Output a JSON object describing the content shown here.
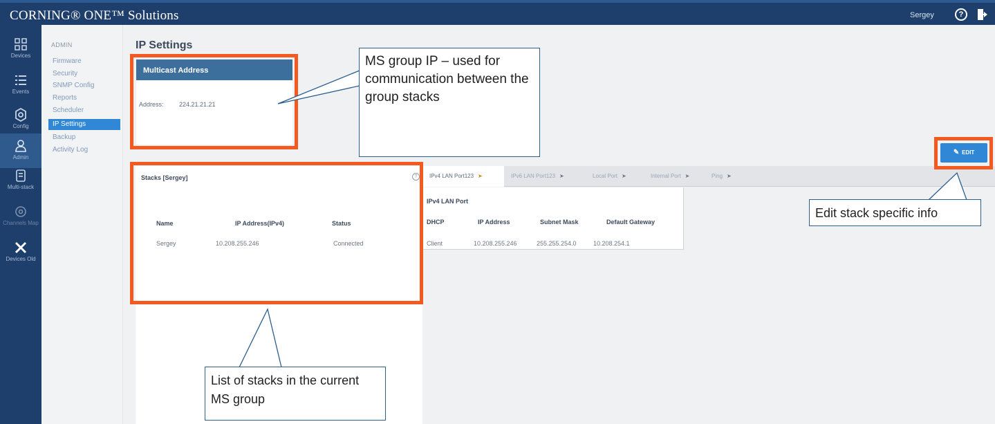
{
  "header": {
    "brand": "CORNING® ONE™ Solutions",
    "user": "Sergey",
    "help_icon": "help-circle-icon",
    "logout_icon": "logout-icon",
    "color": "#1e3f6b"
  },
  "leftnav": {
    "items": [
      {
        "label": "Devices",
        "icon": "grid-icon"
      },
      {
        "label": "Events",
        "icon": "list-icon"
      },
      {
        "label": "Config",
        "icon": "gear-icon"
      },
      {
        "label": "Admin",
        "icon": "person-icon",
        "active": true
      },
      {
        "label": "Multi-stack",
        "icon": "document-icon"
      },
      {
        "label": "Channels Map",
        "icon": "circle-icon",
        "disabled": true
      },
      {
        "label": "Devices Old",
        "icon": "tools-icon"
      }
    ]
  },
  "submenu": {
    "heading": "ADMIN",
    "items": [
      "Firmware",
      "Security",
      "SNMP Config",
      "Reports",
      "Scheduler",
      "IP Settings",
      "Backup",
      "Activity Log"
    ],
    "selected": "IP Settings",
    "accent": "#2f87d6"
  },
  "page": {
    "title": "IP Settings"
  },
  "multicast": {
    "title": "Multicast Address",
    "address_label": "Address:",
    "address_value": "224.21.21.21"
  },
  "edit_button": {
    "label": "EDIT",
    "icon": "pencil-icon"
  },
  "stacks": {
    "title": "Stacks [Sergey]",
    "columns": [
      "Name",
      "IP Address(IPv4)",
      "Status"
    ],
    "rows": [
      [
        "Sergey",
        "10.208.255.246",
        "Connected"
      ]
    ]
  },
  "tabs": [
    {
      "label": "IPv4 LAN Port123",
      "active": true
    },
    {
      "label": "IPv6 LAN Port123"
    },
    {
      "label": "Local Port"
    },
    {
      "label": "Internal Port"
    },
    {
      "label": "Ping"
    }
  ],
  "ipv4": {
    "title": "IPv4 LAN Port",
    "columns": [
      "DHCP",
      "IP Address",
      "Subnet Mask",
      "Default Gateway"
    ],
    "rows": [
      [
        "Client",
        "10.208.255.246",
        "255.255.254.0",
        "10.208.254.1"
      ]
    ]
  },
  "annotations": {
    "highlight_color": "#f4591f",
    "callout_border": "#2b5d8f",
    "ms_group_ip": "MS group IP – used for communication between the group stacks",
    "edit_info": "Edit stack specific info",
    "stack_list": "List of stacks in the current MS group"
  }
}
